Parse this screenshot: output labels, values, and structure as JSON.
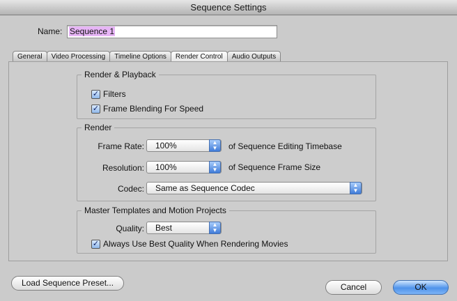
{
  "window": {
    "title": "Sequence Settings"
  },
  "name_field": {
    "label": "Name:",
    "value": "Sequence 1"
  },
  "tabs": [
    {
      "label": "General",
      "active": false
    },
    {
      "label": "Video Processing",
      "active": false
    },
    {
      "label": "Timeline Options",
      "active": false
    },
    {
      "label": "Render Control",
      "active": true
    },
    {
      "label": "Audio Outputs",
      "active": false
    }
  ],
  "render_playback": {
    "title": "Render & Playback",
    "filters": {
      "label": "Filters",
      "checked": true
    },
    "frame_blending": {
      "label": "Frame Blending For Speed",
      "checked": true
    }
  },
  "render": {
    "title": "Render",
    "frame_rate": {
      "label": "Frame Rate:",
      "value": "100%",
      "suffix": "of Sequence Editing Timebase"
    },
    "resolution": {
      "label": "Resolution:",
      "value": "100%",
      "suffix": "of Sequence Frame Size"
    },
    "codec": {
      "label": "Codec:",
      "value": "Same as Sequence Codec"
    }
  },
  "master_templates": {
    "title": "Master Templates and Motion Projects",
    "quality": {
      "label": "Quality:",
      "value": "Best"
    },
    "always_best": {
      "label": "Always Use Best Quality When Rendering Movies",
      "checked": true
    }
  },
  "buttons": {
    "load_preset": "Load Sequence Preset...",
    "cancel": "Cancel",
    "ok": "OK"
  },
  "colors": {
    "selection_highlight": "#e7b5f6",
    "default_button": "#4f93ea",
    "window_background": "#cbcbcb"
  },
  "icons": {
    "checkbox_checked": "checkmark-icon",
    "popup_arrows": "updown-arrows-icon"
  }
}
